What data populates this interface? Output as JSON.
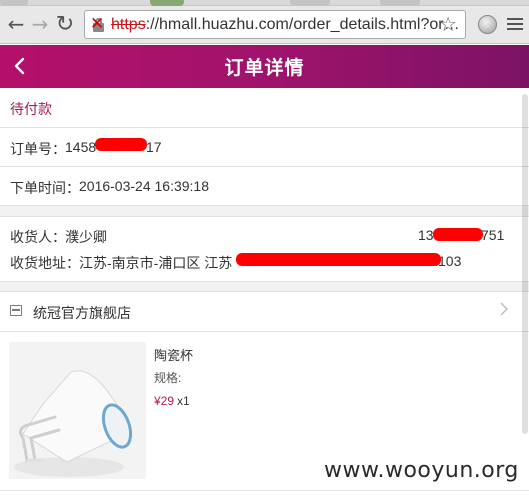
{
  "browser": {
    "url_scheme": "https",
    "url_rest": "://hmall.huazhu.com/order_details.html?or…",
    "back_glyph": "←",
    "forward_glyph": "→",
    "reload_glyph": "↻",
    "star_glyph": "☆",
    "icons": {
      "back": "back-arrow-icon",
      "forward": "forward-arrow-icon",
      "reload": "reload-icon",
      "security": "insecure-lock-icon",
      "bookmark": "star-icon",
      "extension": "extension-icon",
      "menu": "hamburger-menu-icon"
    }
  },
  "header": {
    "title": "订单详情",
    "back_icon": "chevron-left-icon",
    "gradient_start": "#b4106a",
    "gradient_end": "#7b1363"
  },
  "order": {
    "status": "待付款",
    "number_label": "订单号：",
    "number_prefix": "1458",
    "number_suffix": "17",
    "time_label": "下单时间：",
    "time_value": "2016-03-24 16:39:18"
  },
  "recipient": {
    "name_label": "收货人：",
    "name_value": "濮少卿",
    "phone_prefix": "13",
    "phone_suffix": "751",
    "address_label": "收货地址：",
    "address_value": "江苏-南京市-浦口区 江苏",
    "address_suffix": "103"
  },
  "store": {
    "name": "统冠官方旗舰店",
    "icon": "store-icon",
    "chevron": "chevron-right-icon"
  },
  "product": {
    "name": "陶瓷杯",
    "spec_label": "规格:",
    "price": "¥29",
    "quantity": "x1"
  },
  "watermark": "www.wooyun.org",
  "colors": {
    "accent": "#a31c57",
    "redaction": "#ff0000",
    "section_gap": "#f2f2f2"
  }
}
